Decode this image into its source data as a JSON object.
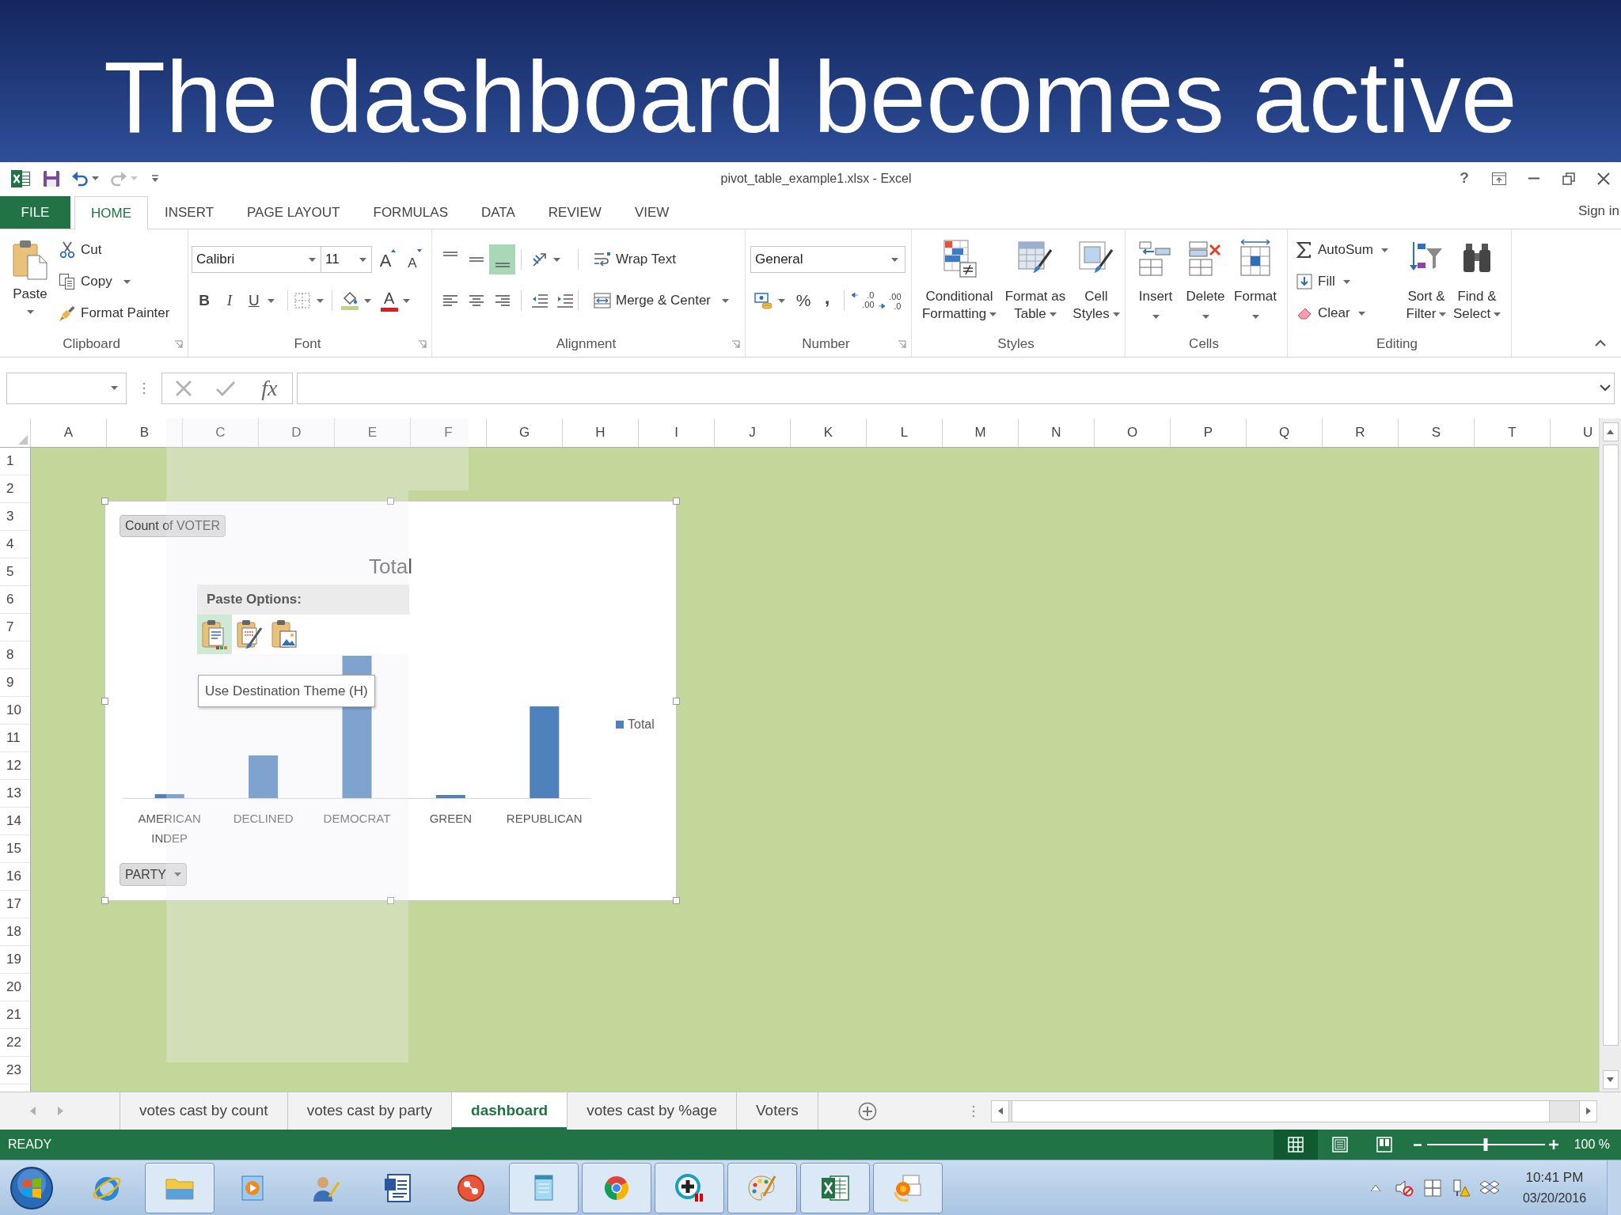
{
  "slide": {
    "title": "The dashboard becomes active"
  },
  "window": {
    "title": "pivot_table_example1.xlsx - Excel",
    "help": "?",
    "quick_access": [
      {
        "kind": "save"
      },
      {
        "kind": "undo",
        "disabled": false
      },
      {
        "kind": "redo",
        "disabled": true
      },
      {
        "kind": "customize"
      }
    ]
  },
  "ribbon": {
    "tabs": [
      {
        "label": "FILE",
        "kind": "file",
        "selected": false
      },
      {
        "label": "HOME",
        "kind": "tab",
        "selected": true
      },
      {
        "label": "INSERT",
        "kind": "tab",
        "selected": false
      },
      {
        "label": "PAGE LAYOUT",
        "kind": "tab",
        "selected": false
      },
      {
        "label": "FORMULAS",
        "kind": "tab",
        "selected": false
      },
      {
        "label": "DATA",
        "kind": "tab",
        "selected": false
      },
      {
        "label": "REVIEW",
        "kind": "tab",
        "selected": false
      },
      {
        "label": "VIEW",
        "kind": "tab",
        "selected": false
      }
    ],
    "account": "Sign in",
    "groups": [
      {
        "kind": "clipboard",
        "label": "Clipboard",
        "launcher": true,
        "paste": "Paste",
        "commands": [
          {
            "kind": "cut",
            "label": "Cut",
            "dropdown": false
          },
          {
            "kind": "copy",
            "label": "Copy",
            "dropdown": true
          },
          {
            "kind": "format-painter",
            "label": "Format Painter",
            "dropdown": false
          }
        ]
      },
      {
        "kind": "font",
        "label": "Font",
        "launcher": true,
        "font_name": "Calibri",
        "font_size": "11",
        "size_buttons": [
          {
            "kind": "grow",
            "label": "A"
          },
          {
            "kind": "shrink",
            "label": "A"
          }
        ],
        "style_buttons": [
          {
            "kind": "bold",
            "label": "B",
            "dropdown": false
          },
          {
            "kind": "italic",
            "label": "I",
            "dropdown": false
          },
          {
            "kind": "underline",
            "label": "U",
            "dropdown": true
          }
        ],
        "font_color": "A"
      },
      {
        "kind": "alignment",
        "label": "Alignment",
        "launcher": true,
        "vertical": [
          {
            "kind": "top",
            "selected": false
          },
          {
            "kind": "middle",
            "selected": false
          },
          {
            "kind": "bottom",
            "selected": true
          }
        ],
        "horizontal": [
          {
            "kind": "left",
            "selected": false
          },
          {
            "kind": "center",
            "selected": false
          },
          {
            "kind": "right",
            "selected": false
          }
        ],
        "wrap_text": "Wrap Text",
        "merge": "Merge & Center"
      },
      {
        "kind": "number",
        "label": "Number",
        "launcher": true,
        "format": "General",
        "symbols": [
          {
            "kind": "percent",
            "label": "%"
          },
          {
            "kind": "comma",
            "label": ","
          }
        ],
        "decimals": [
          {
            "kind": "increase",
            "label": ".0 .00"
          },
          {
            "kind": "decrease",
            "label": ".00 .0"
          }
        ]
      },
      {
        "kind": "styles",
        "label": "Styles",
        "launcher": false,
        "commands": [
          {
            "kind": "conditional-formatting",
            "label": "Conditional Formatting"
          },
          {
            "kind": "format-as-table",
            "label": "Format as Table"
          },
          {
            "kind": "cell-styles",
            "label": "Cell Styles"
          }
        ]
      },
      {
        "kind": "cells",
        "label": "Cells",
        "launcher": false,
        "commands": [
          {
            "kind": "insert",
            "label": "Insert"
          },
          {
            "kind": "delete",
            "label": "Delete"
          },
          {
            "kind": "format",
            "label": "Format"
          }
        ]
      },
      {
        "kind": "editing",
        "label": "Editing",
        "launcher": false,
        "small": [
          {
            "kind": "autosum",
            "label": "AutoSum"
          },
          {
            "kind": "fill",
            "label": "Fill"
          },
          {
            "kind": "clear",
            "label": "Clear"
          }
        ],
        "large": [
          {
            "kind": "sort-filter",
            "label": "Sort & Filter"
          },
          {
            "kind": "find-select",
            "label": "Find & Select"
          }
        ]
      }
    ]
  },
  "formula_bar": {
    "function_label": "fx"
  },
  "sheet": {
    "columns": [
      "A",
      "B",
      "C",
      "D",
      "E",
      "F",
      "G",
      "H",
      "I",
      "J",
      "K",
      "L",
      "M",
      "N",
      "O",
      "P",
      "Q",
      "R",
      "S",
      "T",
      "U"
    ],
    "rows": [
      "1",
      "2",
      "3",
      "4",
      "5",
      "6",
      "7",
      "8",
      "9",
      "10",
      "11",
      "12",
      "13",
      "14",
      "15",
      "16",
      "17",
      "18",
      "19",
      "20",
      "21",
      "22",
      "23"
    ]
  },
  "chart": {
    "value_field": "Count of VOTER",
    "title": "Total",
    "categories": [
      "AMERICAN INDEP",
      "DECLINED",
      "DEMOCRAT",
      "GREEN",
      "REPUBLICAN"
    ],
    "legend": "Total",
    "axis_field": "PARTY"
  },
  "paste_options": {
    "title": "Paste Options:",
    "options": [
      {
        "kind": "destination-theme",
        "selected": true
      },
      {
        "kind": "source-formatting",
        "selected": false
      },
      {
        "kind": "picture",
        "selected": false
      }
    ],
    "tooltip": "Use Destination Theme (H)"
  },
  "sheet_tabs": [
    {
      "label": "votes cast by count",
      "selected": false
    },
    {
      "label": "votes cast by party",
      "selected": false
    },
    {
      "label": "dashboard",
      "selected": true
    },
    {
      "label": "votes cast by %age",
      "selected": false
    },
    {
      "label": "Voters",
      "selected": false
    }
  ],
  "status_bar": {
    "mode": "READY",
    "views": [
      {
        "kind": "normal",
        "selected": true
      },
      {
        "kind": "page-layout",
        "selected": false
      },
      {
        "kind": "page-break",
        "selected": false
      }
    ],
    "zoom": {
      "level": 0.5,
      "reading": "100 %"
    }
  },
  "taskbar": {
    "apps": [
      {
        "kind": "browser-e",
        "running": false
      },
      {
        "kind": "folder",
        "running": true
      },
      {
        "kind": "media",
        "running": false
      },
      {
        "kind": "user",
        "running": false
      },
      {
        "kind": "document",
        "running": false
      },
      {
        "kind": "circle-app",
        "running": false
      },
      {
        "kind": "notepad",
        "running": true
      },
      {
        "kind": "browser-round",
        "running": true
      },
      {
        "kind": "medical",
        "running": true
      },
      {
        "kind": "palette",
        "running": true
      },
      {
        "kind": "spreadsheet",
        "running": true
      },
      {
        "kind": "photos",
        "running": true
      }
    ],
    "clock": {
      "time": "10:41 PM",
      "date": "03/20/2016"
    }
  }
}
